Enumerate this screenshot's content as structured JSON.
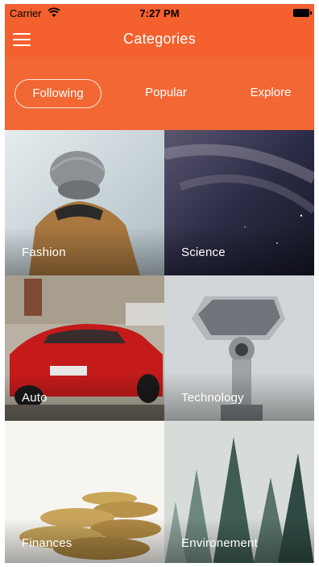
{
  "status_bar": {
    "carrier": "Carrier",
    "time": "7:27 PM"
  },
  "nav": {
    "title": "Categories",
    "menu_icon": "hamburger-menu-icon"
  },
  "tabs": [
    {
      "label": "Following",
      "active": true
    },
    {
      "label": "Popular",
      "active": false
    },
    {
      "label": "Explore",
      "active": false
    }
  ],
  "categories": [
    {
      "label": "Fashion"
    },
    {
      "label": "Science"
    },
    {
      "label": "Auto"
    },
    {
      "label": "Technology"
    },
    {
      "label": "Finances"
    },
    {
      "label": "Environement"
    }
  ],
  "colors": {
    "accent": "#f4612e",
    "tab_bar": "#f26733"
  }
}
